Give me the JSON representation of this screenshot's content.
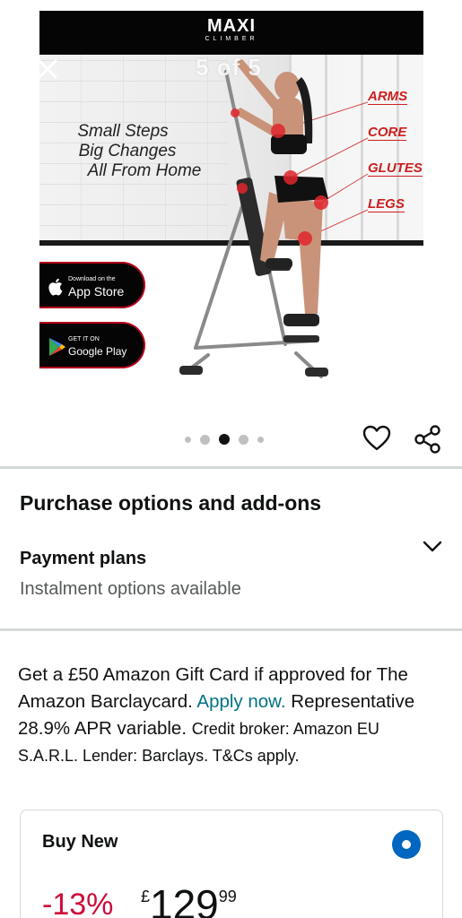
{
  "gallery": {
    "brand": "MAXI",
    "brand_sub": "CLIMBER",
    "counter": "5 of 5",
    "tagline": [
      "Small Steps",
      "Big Changes",
      "All From Home"
    ],
    "body_labels": [
      "ARMS",
      "CORE",
      "GLUTES",
      "LEGS"
    ],
    "app_store": {
      "small": "Download on the",
      "big": "App Store"
    },
    "google_play": {
      "small": "GET IT ON",
      "big": "Google Play"
    },
    "dots": {
      "count": 5,
      "active_index": 2
    },
    "accent_color": "#cc1f1f",
    "icons": [
      "close-icon",
      "heart-icon",
      "share-icon"
    ]
  },
  "purchase": {
    "section_title": "Purchase options and add-ons",
    "payment_plans_title": "Payment plans",
    "payment_plans_sub": "Instalment options available"
  },
  "offer": {
    "text_1": "Get a £50 Amazon Gift Card if approved for The Amazon Barclaycard. ",
    "link": "Apply now.",
    "text_2": " Representative 28.9% APR variable. ",
    "small": "Credit broker: Amazon EU S.A.R.L. Lender: Barclays. T&Cs apply."
  },
  "buy_new": {
    "title": "Buy New",
    "selected": true,
    "discount": "-13%",
    "currency": "£",
    "whole": "129",
    "fraction": "99"
  }
}
